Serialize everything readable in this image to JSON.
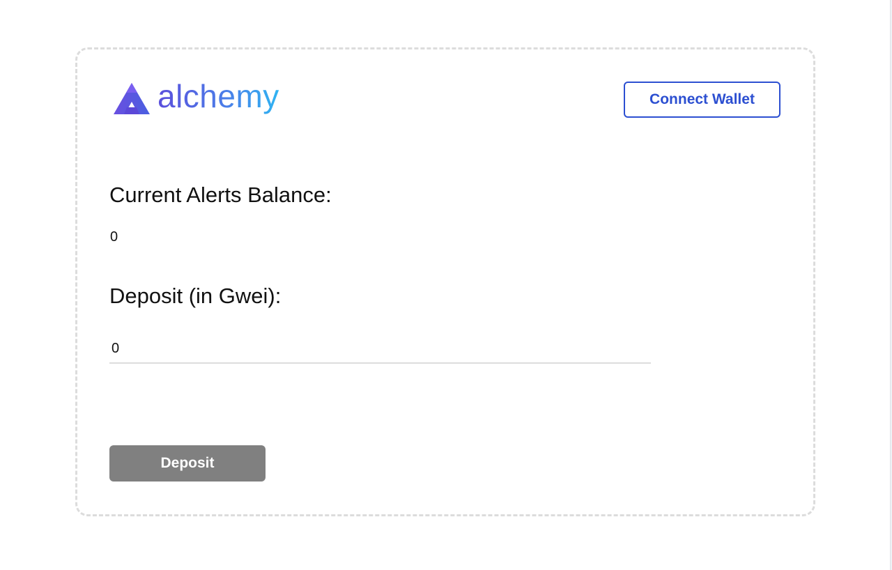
{
  "brand": {
    "name": "alchemy",
    "logo_icon": "alchemy-triangle-icon",
    "colors": {
      "gradient_start": "#5b4fdc",
      "gradient_end": "#2fb4f2"
    }
  },
  "header": {
    "connect_wallet_label": "Connect Wallet"
  },
  "balance": {
    "label": "Current Alerts Balance:",
    "value": "0"
  },
  "deposit": {
    "label": "Deposit (in Gwei):",
    "input_value": "0",
    "button_label": "Deposit",
    "button_color": "#808080"
  },
  "accent_color": "#2c4fd1"
}
